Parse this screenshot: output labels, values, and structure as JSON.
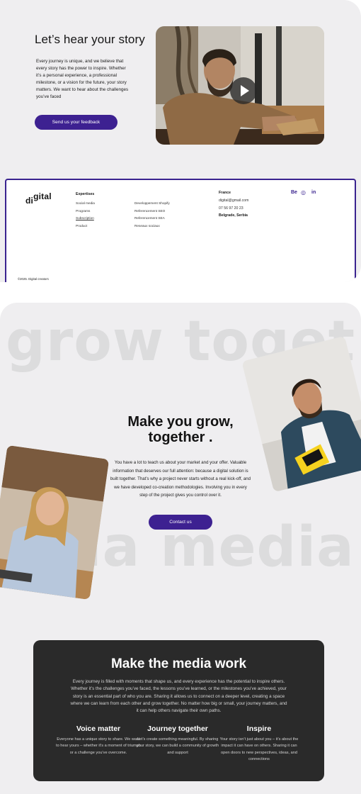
{
  "story": {
    "title": "Let’s hear your story",
    "text": "Every journey is unique, and we believe that every story has the power to inspire. Whether it’s a personal experience, a professional milestone, or a vision for the future, your story matters. We want to hear about the challenges you’ve faced",
    "button": "Send us your feedback",
    "play_icon": "play-icon"
  },
  "footer": {
    "logo": {
      "part1": "di",
      "part2": "gital"
    },
    "heading": "Expertises",
    "col1": [
      "Social media",
      "Programs",
      "Subscription",
      "Product"
    ],
    "col2": [
      "Developpement Shopify",
      "Referencement SEO",
      "Referencement SEA",
      "Reseaux sociaux"
    ],
    "country": "France",
    "email": "digital@gmail.com",
    "phone": "07 56 97 20 23",
    "city": "Belgrade, Serbia",
    "social": [
      "Be",
      "◎",
      "in"
    ],
    "copyright": "©2025. Digital creators"
  },
  "grow": {
    "watermark_top": "grow toget",
    "watermark_bottom": "dia media",
    "title": "Make you grow, together .",
    "text": "You have a lot to teach us about your market and your offer. Valuable information that deserves our full attention: because a digital solution is built together. That’s why a project never starts without a real kick-off, and we have developed co-creation methodologies. Involving you in every step of the project gives you control over it.",
    "button": "Contact us"
  },
  "media": {
    "title": "Make the media work",
    "text": "Every journey is filled with moments that shape us, and every experience has the potential to inspire others. Whether it’s the challenges you’ve faced, the lessons you’ve learned, or the milestones you’ve achieved, your story is an essential part of who you are. Sharing it allows us to connect on a deeper level, creating a space where we can learn from each other and grow together. No matter how big or small, your journey matters, and it can help others navigate their own paths.",
    "columns": [
      {
        "title": "Voice matter",
        "text": "Everyone has a unique story to share. We want to hear yours – whether it’s a moment of triumph or a challenge you’ve overcome."
      },
      {
        "title": "Journey together",
        "text": "Let’s create something meaningful. By sharing your story, we can build a community of growth and support"
      },
      {
        "title": "Inspire",
        "text": "Your story isn’t just about you – it’s about the impact it can have on others. Sharing it can open doors to new perspectives, ideas, and connections"
      }
    ]
  },
  "colors": {
    "accent": "#3d2191",
    "card_bg": "#efeef0",
    "dark_card": "#2a2a2a"
  }
}
